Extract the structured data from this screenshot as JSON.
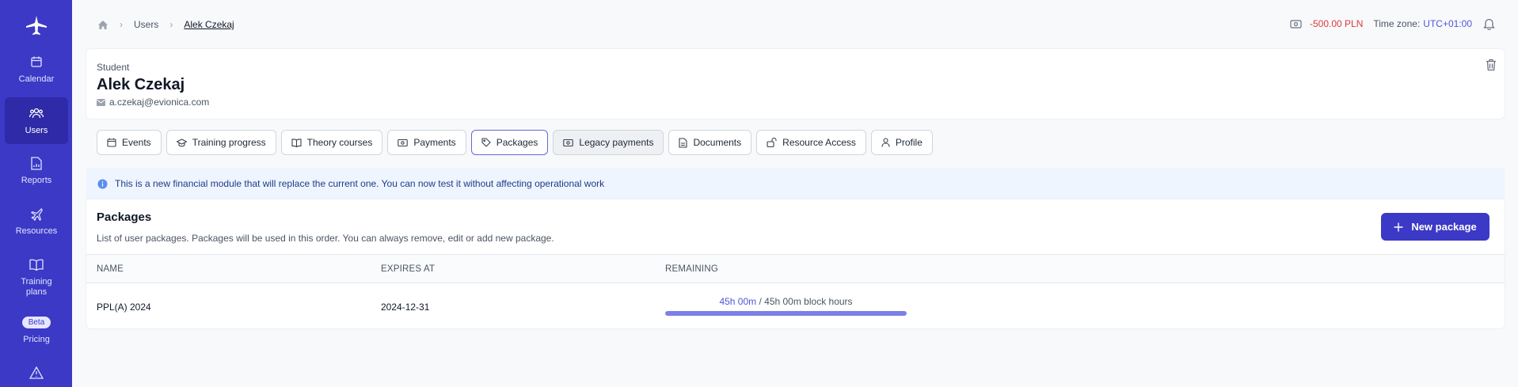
{
  "sidebar": {
    "items": [
      {
        "label": "Calendar",
        "icon": "calendar-icon"
      },
      {
        "label": "Users",
        "icon": "users-icon"
      },
      {
        "label": "Reports",
        "icon": "report-icon"
      },
      {
        "label": "Resources",
        "icon": "airplane-icon"
      },
      {
        "label": "Training plans",
        "icon": "book-icon"
      },
      {
        "label": "Pricing",
        "icon": "price-icon",
        "badge": "Beta"
      }
    ]
  },
  "breadcrumb": {
    "items": [
      "Users",
      "Alek Czekaj"
    ]
  },
  "header_right": {
    "balance": "-500.00 PLN",
    "tz_label": "Time zone:",
    "tz_value": "UTC+01:00"
  },
  "profile": {
    "role": "Student",
    "name": "Alek Czekaj",
    "email": "a.czekaj@evionica.com"
  },
  "tabs": [
    {
      "label": "Events",
      "icon": "calendar-icon"
    },
    {
      "label": "Training progress",
      "icon": "graduation-icon"
    },
    {
      "label": "Theory courses",
      "icon": "book-icon"
    },
    {
      "label": "Payments",
      "icon": "money-icon"
    },
    {
      "label": "Packages",
      "icon": "tag-icon"
    },
    {
      "label": "Legacy payments",
      "icon": "money-icon"
    },
    {
      "label": "Documents",
      "icon": "document-icon"
    },
    {
      "label": "Resource Access",
      "icon": "unlock-icon"
    },
    {
      "label": "Profile",
      "icon": "person-icon"
    }
  ],
  "active_tab": "Packages",
  "info_banner": "This is a new financial module that will replace the current one. You can now test it without affecting operational work",
  "packages": {
    "title": "Packages",
    "subtitle": "List of user packages. Packages will be used in this order. You can always remove, edit or add new package.",
    "new_button": "New package",
    "columns": [
      "NAME",
      "EXPIRES AT",
      "REMAINING"
    ],
    "rows": [
      {
        "name": "PPL(A) 2024",
        "expires": "2024-12-31",
        "remaining": "45h 00m",
        "total": "/ 45h 00m block hours",
        "progress": 1.0
      }
    ]
  },
  "colors": {
    "accent": "#3c39c6",
    "negative": "#dc3a3a",
    "link": "#4f56d6"
  }
}
